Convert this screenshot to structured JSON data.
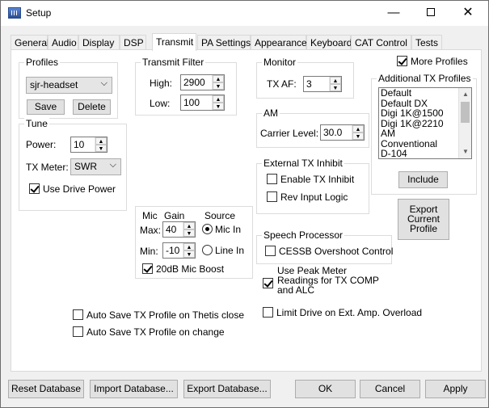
{
  "window": {
    "title": "Setup",
    "minimize": "—",
    "close": "✕"
  },
  "tabs": [
    "General",
    "Audio",
    "Display",
    "DSP",
    "Transmit",
    "PA Settings",
    "Appearance",
    "Keyboard",
    "CAT Control",
    "Tests"
  ],
  "active_tab": "Transmit",
  "profiles": {
    "title": "Profiles",
    "selected": "sjr-headset",
    "save": "Save",
    "delete": "Delete"
  },
  "tune": {
    "title": "Tune",
    "power_label": "Power:",
    "power_value": "10",
    "tx_meter_label": "TX Meter:",
    "tx_meter_value": "SWR",
    "use_drive_power": "Use Drive Power",
    "use_drive_power_checked": true
  },
  "transmit_filter": {
    "title": "Transmit Filter",
    "high_label": "High:",
    "high_value": "2900",
    "low_label": "Low:",
    "low_value": "100"
  },
  "monitor": {
    "title": "Monitor",
    "tx_af_label": "TX AF:",
    "tx_af_value": "3"
  },
  "am": {
    "title": "AM",
    "carrier_label": "Carrier Level:",
    "carrier_value": "30.0"
  },
  "ext_tx_inhibit": {
    "title": "External TX Inhibit",
    "enable": "Enable TX Inhibit",
    "rev_logic": "Rev Input Logic"
  },
  "mic": {
    "mic_header": "Mic",
    "gain_header": "Gain",
    "source_header": "Source",
    "max_label": "Max:",
    "max_value": "40",
    "min_label": "Min:",
    "min_value": "-10",
    "mic_in": "Mic In",
    "line_in": "Line In",
    "boost": "20dB Mic Boost",
    "boost_checked": true
  },
  "more_profiles": {
    "label": "More Profiles",
    "checked": true
  },
  "additional_profiles": {
    "title": "Additional TX Profiles",
    "items": [
      "Default",
      "Default DX",
      "Digi 1K@1500",
      "Digi 1K@2210",
      "AM",
      "Conventional",
      "D-104"
    ],
    "include": "Include"
  },
  "export_profile": {
    "line1": "Export",
    "line2": "Current",
    "line3": "Profile"
  },
  "speech_processor": {
    "title": "Speech Processor",
    "cessb": "CESSB Overshoot Control"
  },
  "peak_meter": {
    "line1": "Use Peak Meter",
    "line2": "Readings for TX COMP",
    "line3": "and ALC",
    "checked": true
  },
  "limit_drive": "Limit Drive on Ext. Amp. Overload",
  "autosave_close": "Auto Save TX Profile on Thetis close",
  "autosave_change": "Auto Save TX Profile on change",
  "footer": {
    "reset": "Reset Database",
    "import": "Import Database...",
    "export": "Export Database...",
    "ok": "OK",
    "cancel": "Cancel",
    "apply": "Apply"
  }
}
